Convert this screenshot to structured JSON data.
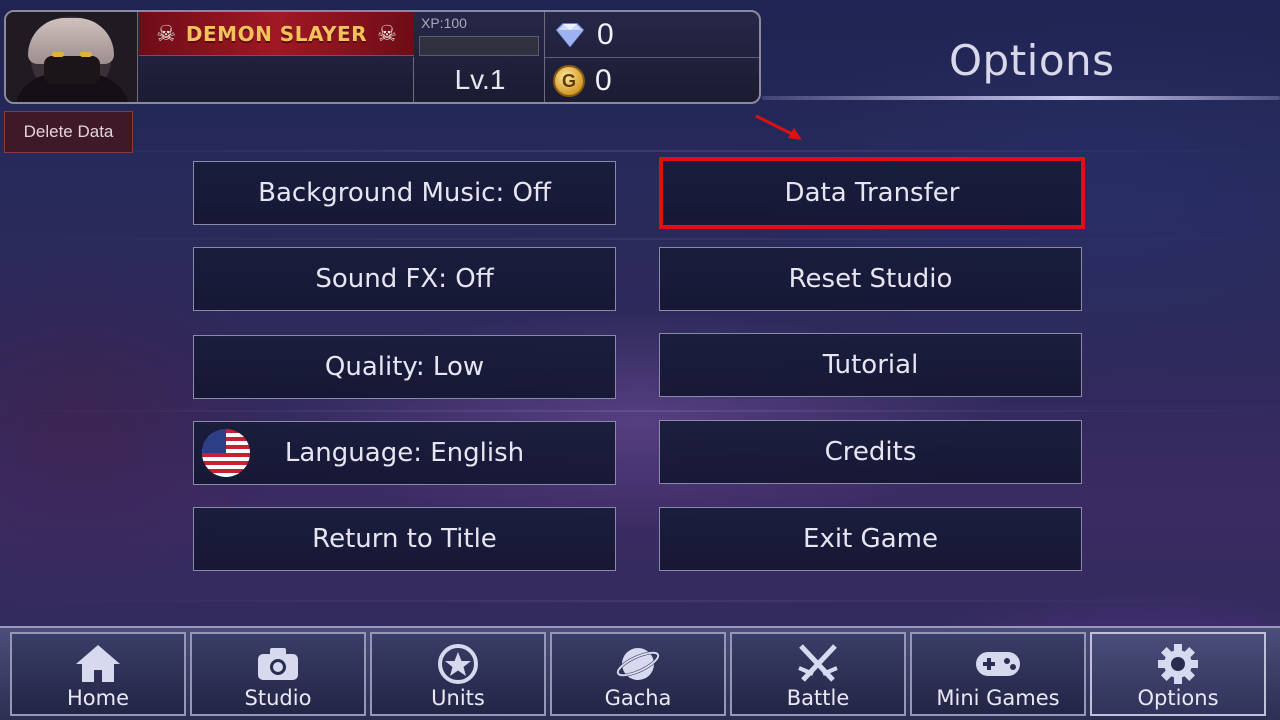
{
  "header": {
    "game_title": "DEMON SLAYER",
    "xp_label": "XP:100",
    "xp_progress": 0,
    "level": "Lv.1",
    "gems": "0",
    "gold": "0",
    "gold_symbol": "G",
    "skull_left": "☠",
    "skull_right": "☠"
  },
  "screen_title": "Options",
  "delete_data_label": "Delete Data",
  "options": {
    "background_music": "Background Music: Off",
    "data_transfer": "Data Transfer",
    "sound_fx": "Sound FX: Off",
    "reset_studio": "Reset Studio",
    "quality": "Quality: Low",
    "tutorial": "Tutorial",
    "language": "Language: English",
    "credits": "Credits",
    "return_to_title": "Return to Title",
    "exit_game": "Exit Game"
  },
  "nav": {
    "home": "Home",
    "studio": "Studio",
    "units": "Units",
    "gacha": "Gacha",
    "battle": "Battle",
    "mini_games": "Mini Games",
    "options": "Options",
    "active": "Options"
  },
  "colors": {
    "highlight": "#e01010",
    "title_banner": "#a11823",
    "title_text": "#f4c25b"
  },
  "icons": [
    "home-icon",
    "camera-icon",
    "star-icon",
    "planet-icon",
    "crossed-swords-icon",
    "gamepad-icon",
    "gear-icon",
    "diamond-icon",
    "gold-coin-icon",
    "us-flag-icon",
    "skull-icon",
    "arrow-icon"
  ]
}
